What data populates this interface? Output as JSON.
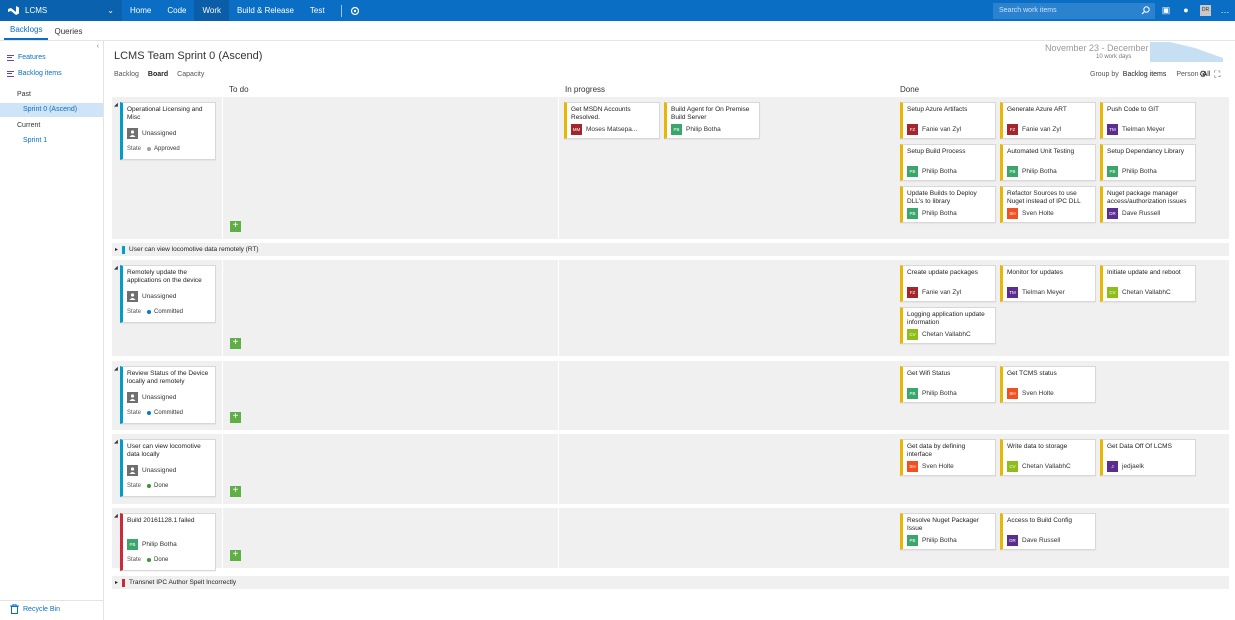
{
  "app": {
    "name": "LCMS"
  },
  "topnav": {
    "items": [
      "Home",
      "Code",
      "Work",
      "Build & Release",
      "Test"
    ],
    "active": "Work"
  },
  "search": {
    "placeholder": "Search work items"
  },
  "user": {
    "initials": "DR"
  },
  "subnav": {
    "tabs": [
      "Backlogs",
      "Queries"
    ],
    "active": "Backlogs"
  },
  "left": {
    "features": "Features",
    "backlog_items": "Backlog items",
    "past": "Past",
    "past_sprint": "Sprint 0 (Ascend)",
    "current": "Current",
    "current_sprint": "Sprint 1",
    "recycle": "Recycle Bin"
  },
  "header": {
    "title": "LCMS Team Sprint 0 (Ascend)",
    "views": [
      "Backlog",
      "Board",
      "Capacity"
    ],
    "active_view": "Board",
    "dates": "November 23 - December 6",
    "workdays": "10 work days",
    "group_by_label": "Group by",
    "group_by_value": "Backlog items",
    "person_label": "Person",
    "person_value": "All"
  },
  "columns": [
    "To do",
    "In progress",
    "Done"
  ],
  "colors": {
    "accent": "#0a6fc4",
    "task": "#e9b700",
    "pbi": "#009ccc",
    "bug": "#cc293d",
    "plus": "#5fae48"
  },
  "state_label": "State",
  "lanes": [
    {
      "parent": {
        "title": "Operational Licensing and Misc",
        "assignee": "Unassigned",
        "initials": "",
        "state": "Approved",
        "dot": "#a0a0a0",
        "kind": "pbi"
      },
      "todo": [],
      "inprogress": [
        {
          "title": "Get MSDN Accounts Resolved.",
          "assignee": "Moses Matsepa...",
          "initials": "MM",
          "color": "#a4262c"
        },
        {
          "title": "Build Agent for On Premise Build Server",
          "assignee": "Philip Botha",
          "initials": "PB",
          "color": "#3aa66b"
        }
      ],
      "done": [
        {
          "title": "Setup Azure Artifacts",
          "assignee": "Fanie van Zyl",
          "initials": "FZ",
          "color": "#a4262c"
        },
        {
          "title": "Generate Azure ART",
          "assignee": "Fanie van Zyl",
          "initials": "FZ",
          "color": "#a4262c"
        },
        {
          "title": "Push Code to GIT",
          "assignee": "Tielman Meyer",
          "initials": "TM",
          "color": "#5c2d91"
        },
        {
          "title": "Setup Build Process",
          "assignee": "Philip Botha",
          "initials": "PB",
          "color": "#3aa66b"
        },
        {
          "title": "Automated Unit Testing",
          "assignee": "Philip Botha",
          "initials": "PB",
          "color": "#3aa66b"
        },
        {
          "title": "Setup Dependancy Library",
          "assignee": "Philip Botha",
          "initials": "PB",
          "color": "#3aa66b"
        },
        {
          "title": "Update Builds to Deploy DLL's to library",
          "assignee": "Philip Botha",
          "initials": "PB",
          "color": "#3aa66b"
        },
        {
          "title": "Refactor Sources to use Nuget instead of IPC DLL",
          "assignee": "Sven Holte",
          "initials": "SH",
          "color": "#f25022"
        },
        {
          "title": "Nuget package manager access/authorization issues",
          "assignee": "Dave Russell",
          "initials": "DR",
          "color": "#5c2d91"
        }
      ]
    },
    {
      "parent": {
        "title": "Remotely update the applications on the device",
        "assignee": "Unassigned",
        "initials": "",
        "state": "Committed",
        "dot": "#007acc",
        "kind": "pbi"
      },
      "todo": [],
      "inprogress": [],
      "done": [
        {
          "title": "Create update packages",
          "assignee": "Fanie van Zyl",
          "initials": "FZ",
          "color": "#a4262c"
        },
        {
          "title": "Monitor for updates",
          "assignee": "Tielman Meyer",
          "initials": "TM",
          "color": "#5c2d91"
        },
        {
          "title": "Initiate update and reboot",
          "assignee": "Chetan VallabhC",
          "initials": "CV",
          "color": "#8cbd18"
        },
        {
          "title": "Logging application update information",
          "assignee": "Chetan VallabhC",
          "initials": "CV",
          "color": "#8cbd18"
        }
      ]
    },
    {
      "parent": {
        "title": "Review Status of the Device locally and remotely",
        "assignee": "Unassigned",
        "initials": "",
        "state": "Committed",
        "dot": "#007acc",
        "kind": "pbi"
      },
      "todo": [],
      "inprogress": [],
      "done": [
        {
          "title": "Get Wifi Status",
          "assignee": "Philip Botha",
          "initials": "PB",
          "color": "#3aa66b"
        },
        {
          "title": "Get TCMS status",
          "assignee": "Sven Holte",
          "initials": "SH",
          "color": "#f25022"
        }
      ]
    },
    {
      "parent": {
        "title": "User can view locomotive data locally",
        "assignee": "Unassigned",
        "initials": "",
        "state": "Done",
        "dot": "#339933",
        "kind": "pbi"
      },
      "todo": [],
      "inprogress": [],
      "done": [
        {
          "title": "Get data by defining interface",
          "assignee": "Sven Holte",
          "initials": "SH",
          "color": "#f25022"
        },
        {
          "title": "Write data to storage",
          "assignee": "Chetan VallabhC",
          "initials": "CV",
          "color": "#8cbd18"
        },
        {
          "title": "Get Data Off Of LCMS",
          "assignee": "jedjaelk",
          "initials": "J",
          "color": "#5c2d91"
        }
      ]
    },
    {
      "parent": {
        "title": "Build 20161128.1 failed",
        "assignee": "Philip Botha",
        "initials": "PB",
        "state": "Done",
        "dot": "#339933",
        "kind": "bug",
        "avcolor": "#3aa66b"
      },
      "todo": [],
      "inprogress": [],
      "done": [
        {
          "title": "Resolve Nuget Packager Issue",
          "assignee": "Philip Botha",
          "initials": "PB",
          "color": "#3aa66b"
        },
        {
          "title": "Access to Build Config",
          "assignee": "Dave Russell",
          "initials": "DR",
          "color": "#5c2d91"
        }
      ]
    }
  ],
  "collapsed_lanes": [
    {
      "title": "User can view locomotive data remotely (RT)",
      "kind": "pbi"
    },
    {
      "title": "Transnet IPC Author Spelt Incorrectly",
      "kind": "bug"
    }
  ]
}
